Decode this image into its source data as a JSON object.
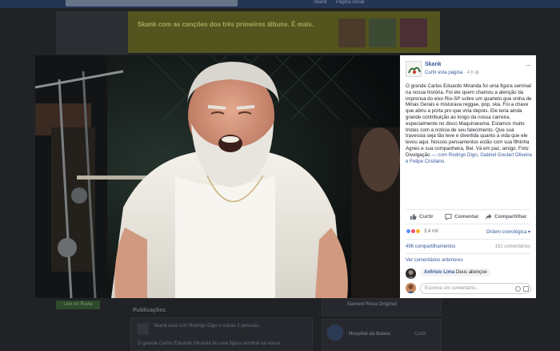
{
  "background": {
    "banner_text": "Skank com as canções dos três primeiros álbuns. É mais.",
    "top_links": [
      "Skank",
      "Página inicial"
    ],
    "button_label": "Live on Ruvia",
    "section_title": "Publicações",
    "post_header": "Skank está com Rodrigo Digo e outras 2 pessoas.",
    "post_snippet": "O grande Carlos Eduardo Miranda foi uma figura seminal na nossa",
    "sidebar_title": "Samuel Rosa Original",
    "sidebar_title_2": "Hospital da Baleia",
    "sidebar_like": "Curtir"
  },
  "post": {
    "page_name": "Skank",
    "like_page": "Curtir esta página",
    "time": "4 h",
    "text": "O grande Carlos Eduardo Miranda foi uma figura seminal na nossa história. Foi ele quem chamou a atenção da imprensa do eixo Rio-SP sobre um quarteto que vinha de Minas Gerais e misturava reggae, pop, ska. Foi a chave que abriu a porta pro que viria depois. Ele teria ainda grande contribuição ao longo da nossa carreira, especialmente no disco Maquinarama. Estamos muito tristes com a notícia de seu falecimento. Que sua travessia seja tão leve e divertida quanto a vida que ele levou aqui. Nossos pensamentos estão com sua filhinha Agnes e sua companheira, Bel. Vá em paz, amigo. Foto: Divulgação",
    "tagged": "— com Rodrigo Digo, Gabriel Goulart Oliveira e Felipe Cristiano."
  },
  "actions": {
    "like": "Curtir",
    "comment": "Comentar",
    "share": "Compartilhar"
  },
  "stats": {
    "reactions_count": "3,4 mil",
    "sort_label": "Ordem cronológica",
    "shares": "496 compartilhamentos",
    "comments": "151 comentários",
    "previous_comments": "Ver comentários anteriores"
  },
  "comment": {
    "author": "Anfrísio Lima",
    "text": "Deus abençoe"
  },
  "composer": {
    "placeholder": "Escreva um comentário..."
  },
  "colors": {
    "link": "#365899",
    "like_reaction": "#5890ff",
    "love_reaction": "#f25268",
    "sad_reaction": "#f7b125"
  },
  "icons": [
    "options-icon",
    "like-icon",
    "comment-icon",
    "share-icon",
    "emoji-icon",
    "camera-icon"
  ]
}
